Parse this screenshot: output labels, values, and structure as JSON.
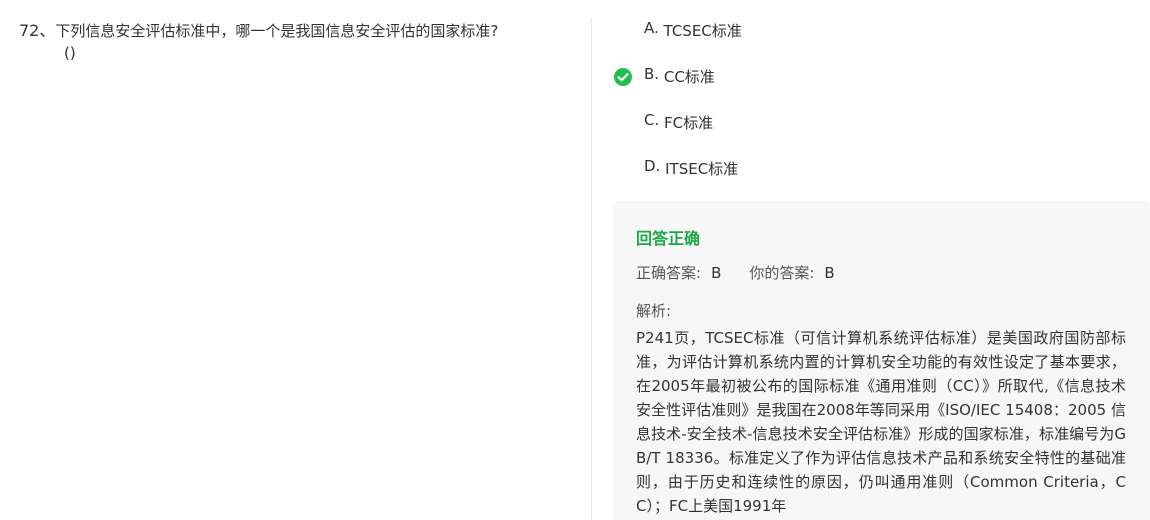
{
  "question": {
    "number": "72、",
    "text": "下列信息安全评估标准中，哪一个是我国信息安全评估的国家标准?",
    "paren": "()"
  },
  "options": [
    {
      "letter": "A.",
      "text": "TCSEC标准"
    },
    {
      "letter": "B.",
      "text": "CC标准"
    },
    {
      "letter": "C.",
      "text": "FC标准"
    },
    {
      "letter": "D.",
      "text": "ITSEC标准"
    }
  ],
  "selected_option": "B",
  "result": {
    "status": "回答正确",
    "correct_label": "正确答案:",
    "correct_value": "B",
    "your_label": "你的答案:",
    "your_value": "B",
    "analysis_label": "解析:",
    "analysis_text": "P241页，TCSEC标准（可信计算机系统评估标准）是美国政府国防部标准，为评估计算机系统内置的计算机安全功能的有效性设定了基本要求，在2005年最初被公布的国际标准《通用准则（CC）》所取代,《信息技术安全性评估准则》是我国在2008年等同采用《ISO/IEC 15408：2005 信息技术-安全技术-信息技术安全评估标准》形成的国家标准，标准编号为GB/T 18336。标准定义了作为评估信息技术产品和系统安全特性的基础准则，由于历史和连续性的原因，仍叫通用准则（Common Criteria，CC）；FC上美国1991年"
  },
  "colors": {
    "accent_green": "#1fbf4e",
    "status_green": "#1fa84a",
    "panel_bg": "#f7f7f7",
    "text": "#333333"
  },
  "icons": {
    "selected": "check-circle-icon"
  }
}
